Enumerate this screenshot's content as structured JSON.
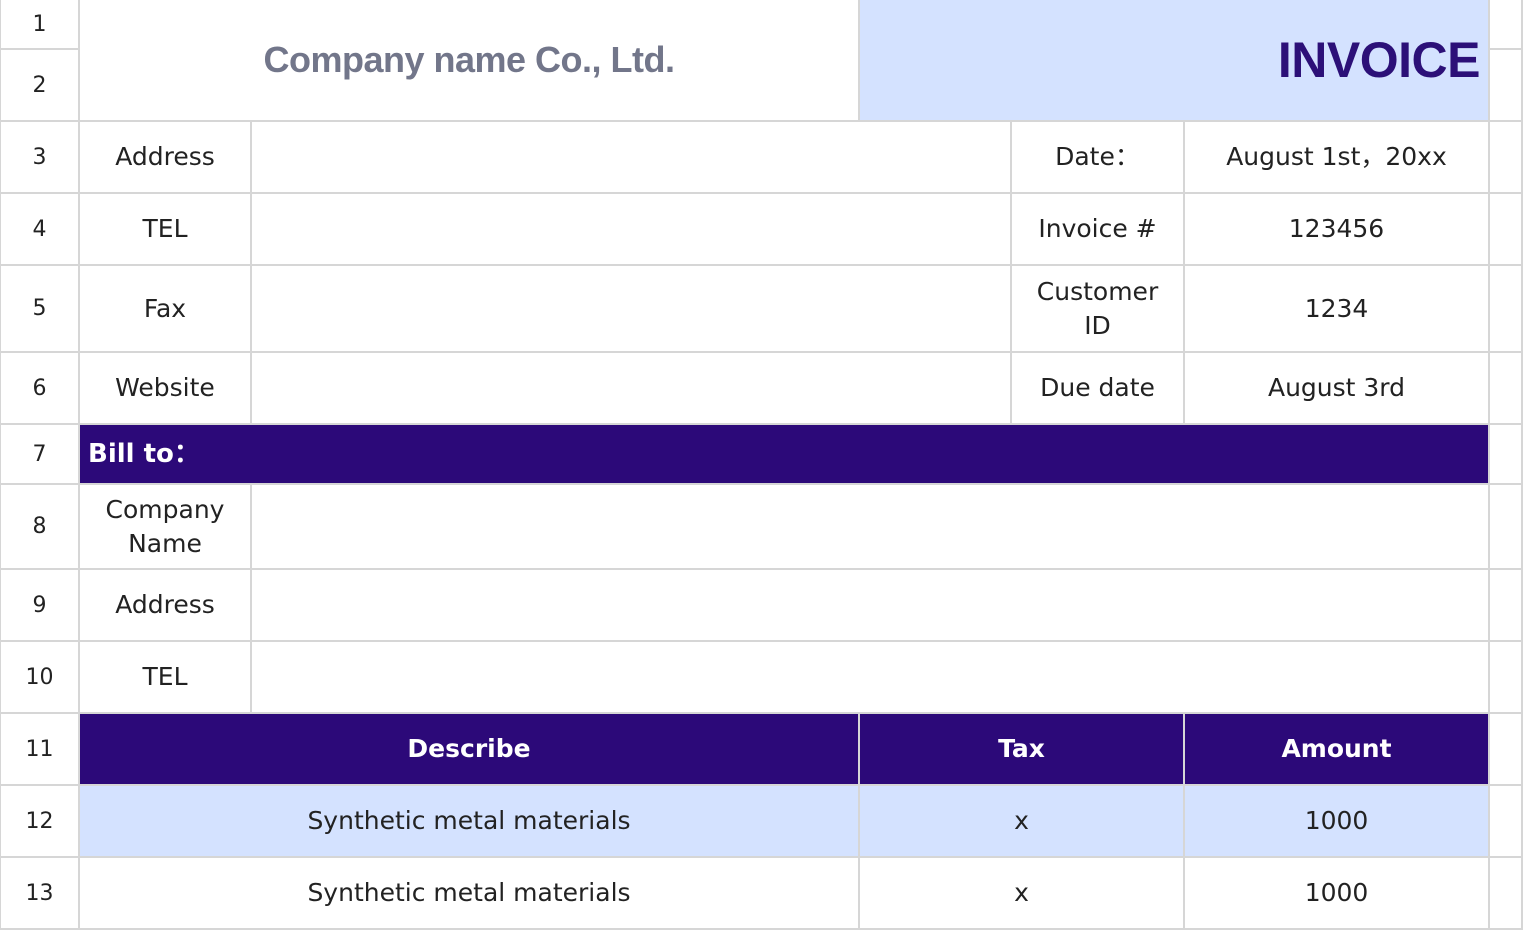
{
  "rows": [
    "1",
    "2",
    "3",
    "4",
    "5",
    "6",
    "7",
    "8",
    "9",
    "10",
    "11",
    "12",
    "13"
  ],
  "header": {
    "company_name": "Company name Co., Ltd.",
    "title": "INVOICE"
  },
  "seller": {
    "address_label": "Address",
    "tel_label": "TEL",
    "fax_label": "Fax",
    "website_label": "Website"
  },
  "meta": {
    "date_label": "Date：",
    "date_value": "August 1st，20xx",
    "invoice_label": "Invoice #",
    "invoice_value": "123456",
    "customer_label": "Customer ID",
    "customer_value": "1234",
    "due_label": "Due date",
    "due_value": "August 3rd"
  },
  "bill_to": {
    "title": "Bill to：",
    "company_label": "Company Name",
    "address_label": "Address",
    "tel_label": "TEL"
  },
  "items": {
    "headers": [
      "Describe",
      "Tax",
      "Amount"
    ],
    "rows": [
      [
        "Synthetic metal materials",
        "x",
        "1000"
      ],
      [
        "Synthetic metal materials",
        "x",
        "1000"
      ]
    ]
  },
  "colors": {
    "accent": "#2c0979",
    "highlight": "#d4e2ff",
    "company_text": "#72768a"
  }
}
